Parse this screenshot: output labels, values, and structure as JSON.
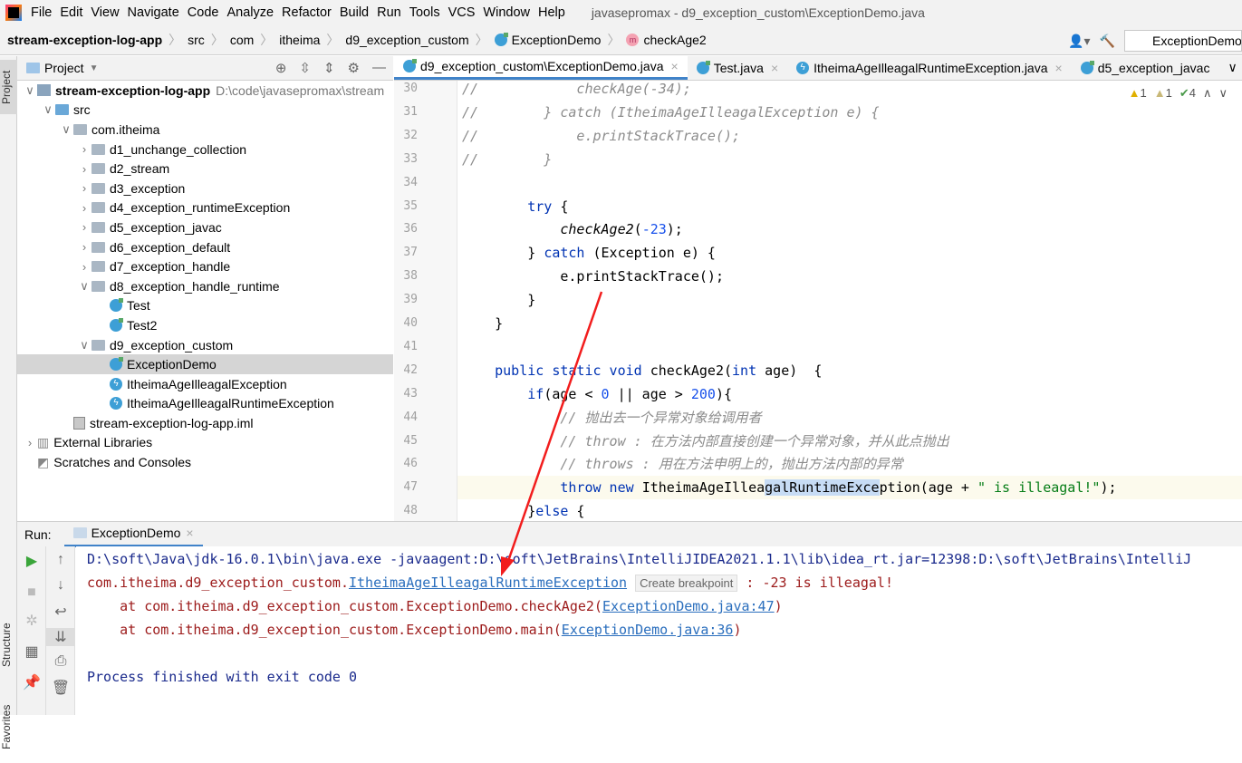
{
  "menubar": {
    "items": [
      "File",
      "Edit",
      "View",
      "Navigate",
      "Code",
      "Analyze",
      "Refactor",
      "Build",
      "Run",
      "Tools",
      "VCS",
      "Window",
      "Help"
    ],
    "title": "javasepromax - d9_exception_custom\\ExceptionDemo.java"
  },
  "breadcrumb": [
    "stream-exception-log-app",
    "src",
    "com",
    "itheima",
    "d9_exception_custom",
    "ExceptionDemo",
    "checkAge2"
  ],
  "run_config": "ExceptionDemo",
  "side_tabs": {
    "project": "Project",
    "structure": "Structure",
    "favorites": "Favorites"
  },
  "project": {
    "title": "Project",
    "tree": [
      {
        "label": "stream-exception-log-app",
        "hint": "D:\\code\\javasepromax\\stream",
        "level": 0,
        "icon": "module",
        "open": true,
        "bold": true
      },
      {
        "label": "src",
        "level": 1,
        "icon": "src",
        "open": true
      },
      {
        "label": "com.itheima",
        "level": 2,
        "icon": "folder",
        "open": true
      },
      {
        "label": "d1_unchange_collection",
        "level": 3,
        "icon": "folder",
        "open": false
      },
      {
        "label": "d2_stream",
        "level": 3,
        "icon": "folder",
        "open": false
      },
      {
        "label": "d3_exception",
        "level": 3,
        "icon": "folder",
        "open": false
      },
      {
        "label": "d4_exception_runtimeException",
        "level": 3,
        "icon": "folder",
        "open": false
      },
      {
        "label": "d5_exception_javac",
        "level": 3,
        "icon": "folder",
        "open": false
      },
      {
        "label": "d6_exception_default",
        "level": 3,
        "icon": "folder",
        "open": false
      },
      {
        "label": "d7_exception_handle",
        "level": 3,
        "icon": "folder",
        "open": false
      },
      {
        "label": "d8_exception_handle_runtime",
        "level": 3,
        "icon": "folder",
        "open": true
      },
      {
        "label": "Test",
        "level": 4,
        "icon": "class"
      },
      {
        "label": "Test2",
        "level": 4,
        "icon": "class"
      },
      {
        "label": "d9_exception_custom",
        "level": 3,
        "icon": "folder",
        "open": true
      },
      {
        "label": "ExceptionDemo",
        "level": 4,
        "icon": "class",
        "selected": true
      },
      {
        "label": "ItheimaAgeIlleagalException",
        "level": 4,
        "icon": "exception"
      },
      {
        "label": "ItheimaAgeIlleagalRuntimeException",
        "level": 4,
        "icon": "exception"
      },
      {
        "label": "stream-exception-log-app.iml",
        "level": 2,
        "icon": "iml"
      },
      {
        "label": "External Libraries",
        "level": 0,
        "icon": "lib",
        "open": false
      },
      {
        "label": "Scratches and Consoles",
        "level": 0,
        "icon": "scratch"
      }
    ]
  },
  "tabs": [
    {
      "label": "d9_exception_custom\\ExceptionDemo.java",
      "icon": "class",
      "active": true
    },
    {
      "label": "Test.java",
      "icon": "class"
    },
    {
      "label": "ItheimaAgeIlleagalRuntimeException.java",
      "icon": "exception"
    },
    {
      "label": "d5_exception_javac",
      "icon": "class"
    }
  ],
  "inspections": {
    "warnings": "1",
    "weak": "1",
    "ok": "4"
  },
  "editor": {
    "current_line": 47,
    "lines": [
      {
        "n": "30",
        "t": [
          [
            "c",
            "//            checkAge(-34);"
          ]
        ]
      },
      {
        "n": "31",
        "t": [
          [
            "c",
            "//        } catch (ItheimaAgeIlleagalException e) {"
          ]
        ]
      },
      {
        "n": "32",
        "t": [
          [
            "c",
            "//            e.printStackTrace();"
          ]
        ]
      },
      {
        "n": "33",
        "t": [
          [
            "c",
            "//        }"
          ]
        ]
      },
      {
        "n": "34",
        "t": []
      },
      {
        "n": "35",
        "t": [
          [
            "p",
            "        "
          ],
          [
            "k",
            "try"
          ],
          [
            "p",
            " {"
          ]
        ]
      },
      {
        "n": "36",
        "t": [
          [
            "p",
            "            "
          ],
          [
            "m",
            "checkAge2"
          ],
          [
            "p",
            "("
          ],
          [
            "n",
            "-23"
          ],
          [
            "p",
            ");"
          ]
        ]
      },
      {
        "n": "37",
        "t": [
          [
            "p",
            "        } "
          ],
          [
            "k",
            "catch"
          ],
          [
            "p",
            " (Exception e) {"
          ]
        ]
      },
      {
        "n": "38",
        "t": [
          [
            "p",
            "            e.printStackTrace();"
          ]
        ]
      },
      {
        "n": "39",
        "t": [
          [
            "p",
            "        }"
          ]
        ]
      },
      {
        "n": "40",
        "t": [
          [
            "p",
            "    }"
          ]
        ]
      },
      {
        "n": "41",
        "t": []
      },
      {
        "n": "42",
        "t": [
          [
            "p",
            "    "
          ],
          [
            "k",
            "public static void "
          ],
          [
            "p",
            "checkAge2("
          ],
          [
            "k",
            "int"
          ],
          [
            "p",
            " age)  {"
          ]
        ]
      },
      {
        "n": "43",
        "t": [
          [
            "p",
            "        "
          ],
          [
            "k",
            "if"
          ],
          [
            "p",
            "(age < "
          ],
          [
            "n",
            "0"
          ],
          [
            "p",
            " || age > "
          ],
          [
            "n",
            "200"
          ],
          [
            "p",
            "){"
          ]
        ]
      },
      {
        "n": "44",
        "t": [
          [
            "c",
            "            // 抛出去一个异常对象给调用者"
          ]
        ]
      },
      {
        "n": "45",
        "t": [
          [
            "c",
            "            // throw : 在方法内部直接创建一个异常对象，并从此点抛出"
          ]
        ]
      },
      {
        "n": "46",
        "t": [
          [
            "c",
            "            // throws : 用在方法申明上的，抛出方法内部的异常"
          ]
        ]
      },
      {
        "n": "47",
        "t": [
          [
            "p",
            "            "
          ],
          [
            "k",
            "throw new "
          ],
          [
            "p",
            "ItheimaAgeIllea"
          ],
          [
            "h",
            "galRuntimeExce"
          ],
          [
            "p",
            "ption(age + "
          ],
          [
            "s",
            "\" is illeagal!\""
          ],
          [
            "p",
            ");"
          ]
        ]
      },
      {
        "n": "48",
        "t": [
          [
            "p",
            "        }"
          ],
          [
            "k",
            "else"
          ],
          [
            "p",
            " {"
          ]
        ]
      }
    ]
  },
  "run": {
    "label": "Run:",
    "tab": "ExceptionDemo",
    "cmd": "D:\\soft\\Java\\jdk-16.0.1\\bin\\java.exe -javaagent:D:\\soft\\JetBrains\\IntelliJIDEA2021.1.1\\lib\\idea_rt.jar=12398:D:\\soft\\JetBrains\\IntelliJ",
    "exc_prefix": "com.itheima.d9_exception_custom.",
    "exc_class": "ItheimaAgeIlleagalRuntimeException",
    "tooltip": "Create breakpoint",
    "exc_msg": " : -23 is illeagal!",
    "st1_prefix": "    at com.itheima.d9_exception_custom.ExceptionDemo.checkAge2(",
    "st1_link": "ExceptionDemo.java:47",
    "st1_suffix": ")",
    "st2_prefix": "    at com.itheima.d9_exception_custom.ExceptionDemo.main(",
    "st2_link": "ExceptionDemo.java:36",
    "st2_suffix": ")",
    "finished": "Process finished with exit code 0"
  },
  "colors": {
    "accent": "#4083c9",
    "annotation_arrow": "#f21d1d"
  }
}
